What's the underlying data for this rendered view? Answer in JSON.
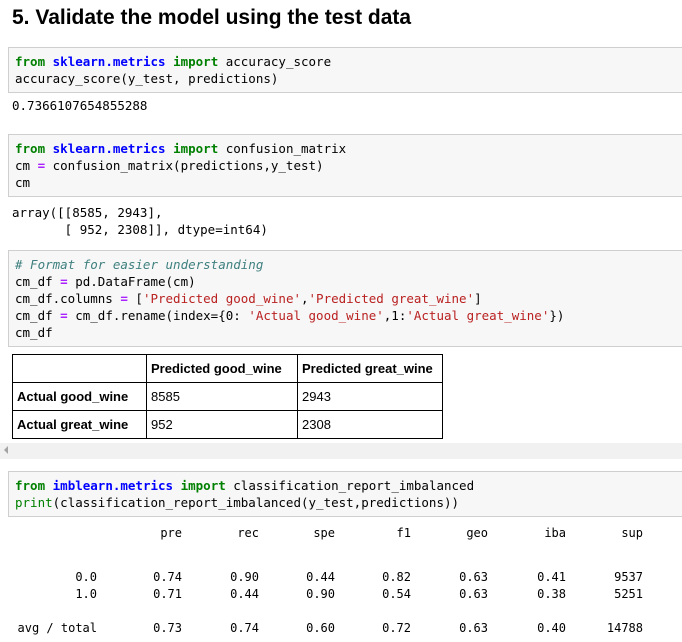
{
  "heading": "5. Validate the model using the test data",
  "cell1": {
    "line1": {
      "kw1": "from",
      "mod": "sklearn.metrics",
      "kw2": "import",
      "rest": "accuracy_score"
    },
    "line2": "accuracy_score(y_test, predictions)"
  },
  "out1": "0.7366107654855288",
  "cell2": {
    "line1": {
      "kw1": "from",
      "mod": "sklearn.metrics",
      "kw2": "import",
      "rest": "confusion_matrix"
    },
    "line2": {
      "a": "cm ",
      "op": "=",
      "b": " confusion_matrix(predictions,y_test)"
    },
    "line3": "cm"
  },
  "out2": {
    "line1": "array([[8585, 2943],",
    "line2": "       [ 952, 2308]], dtype=int64)"
  },
  "cell3": {
    "comment": "# Format for easier understanding",
    "line2": {
      "a": "cm_df ",
      "op": "=",
      "b": " pd.DataFrame(cm)"
    },
    "line3": {
      "a": "cm_df.columns ",
      "op": "=",
      "b": " [",
      "s1": "'Predicted good_wine'",
      "c": ",",
      "s2": "'Predicted great_wine'",
      "d": "]"
    },
    "line4": {
      "a": "cm_df ",
      "op": "=",
      "b": " cm_df.rename(index={0: ",
      "s1": "'Actual good_wine'",
      "c": ",1:",
      "s2": "'Actual great_wine'",
      "d": "})"
    },
    "line5": "cm_df"
  },
  "dataframe": {
    "columns": [
      "Predicted good_wine",
      "Predicted great_wine"
    ],
    "rows": [
      {
        "label": "Actual good_wine",
        "values": [
          "8585",
          "2943"
        ]
      },
      {
        "label": "Actual great_wine",
        "values": [
          "952",
          "2308"
        ]
      }
    ]
  },
  "cell4": {
    "line1": {
      "kw1": "from",
      "mod": "imblearn.metrics",
      "kw2": "import",
      "rest": "classification_report_imbalanced"
    },
    "line2": {
      "bi": "print",
      "rest": "(classification_report_imbalanced(y_test,predictions))"
    }
  },
  "report": {
    "headers": [
      "pre",
      "rec",
      "spe",
      "f1",
      "geo",
      "iba",
      "sup"
    ],
    "rows": [
      {
        "label": "0.0",
        "values": [
          "0.74",
          "0.90",
          "0.44",
          "0.82",
          "0.63",
          "0.41",
          "9537"
        ]
      },
      {
        "label": "1.0",
        "values": [
          "0.71",
          "0.44",
          "0.90",
          "0.54",
          "0.63",
          "0.38",
          "5251"
        ]
      }
    ],
    "total": {
      "label": "avg / total",
      "values": [
        "0.73",
        "0.74",
        "0.60",
        "0.72",
        "0.63",
        "0.40",
        "14788"
      ]
    }
  }
}
